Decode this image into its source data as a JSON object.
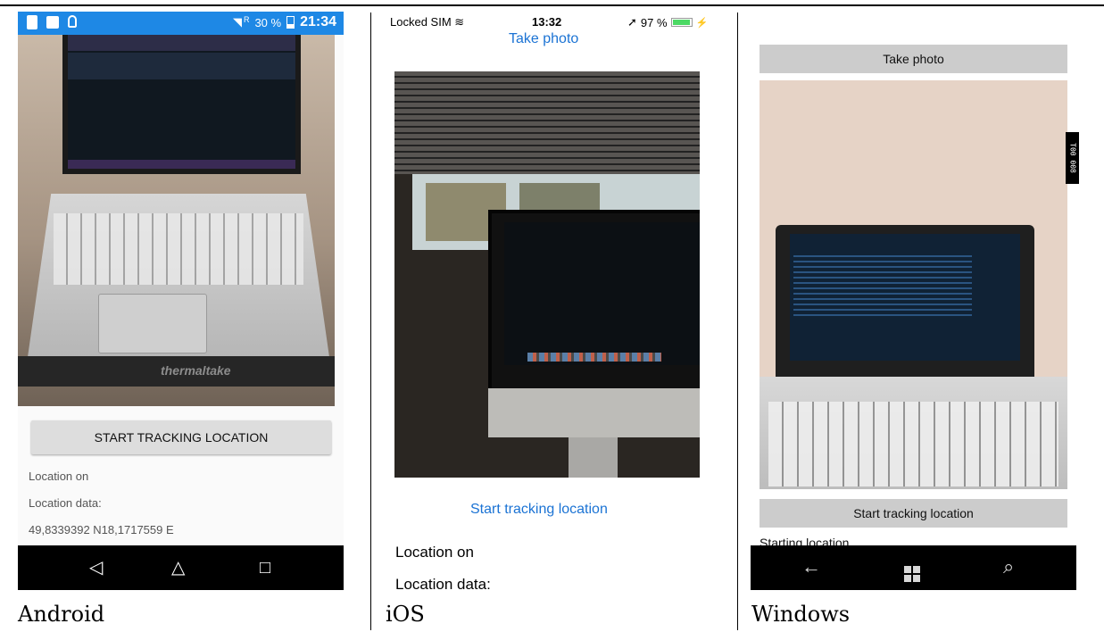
{
  "captions": {
    "android": "Android",
    "ios": "iOS",
    "windows": "Windows"
  },
  "android": {
    "status": {
      "battery_percent": "30 %",
      "time": "21:34",
      "signal": "R"
    },
    "button_label": "START TRACKING LOCATION",
    "status_text": "Location on",
    "data_label": "Location data:",
    "coordinates": "49,8339392 N18,1717559 E",
    "photo_brand": "thermaltake",
    "nav": {
      "back_icon": "◁",
      "home_icon": "△",
      "recents_icon": "□"
    }
  },
  "ios": {
    "status": {
      "carrier": "Locked SIM",
      "time": "13:32",
      "battery_percent": "97 %"
    },
    "take_photo_label": "Take photo",
    "start_tracking_label": "Start tracking location",
    "status_text": "Location on",
    "data_label": "Location data:"
  },
  "windows": {
    "take_photo_label": "Take photo",
    "start_tracking_label": "Start tracking location",
    "partial_text": "Starting location",
    "side_label": "T00 008",
    "nav": {
      "back_icon": "←",
      "search_icon": "⌕"
    }
  },
  "colors": {
    "android_status": "#1e88e5",
    "ios_link": "#1b73d4",
    "windows_button": "#cccccc",
    "nav_bar": "#000000"
  }
}
